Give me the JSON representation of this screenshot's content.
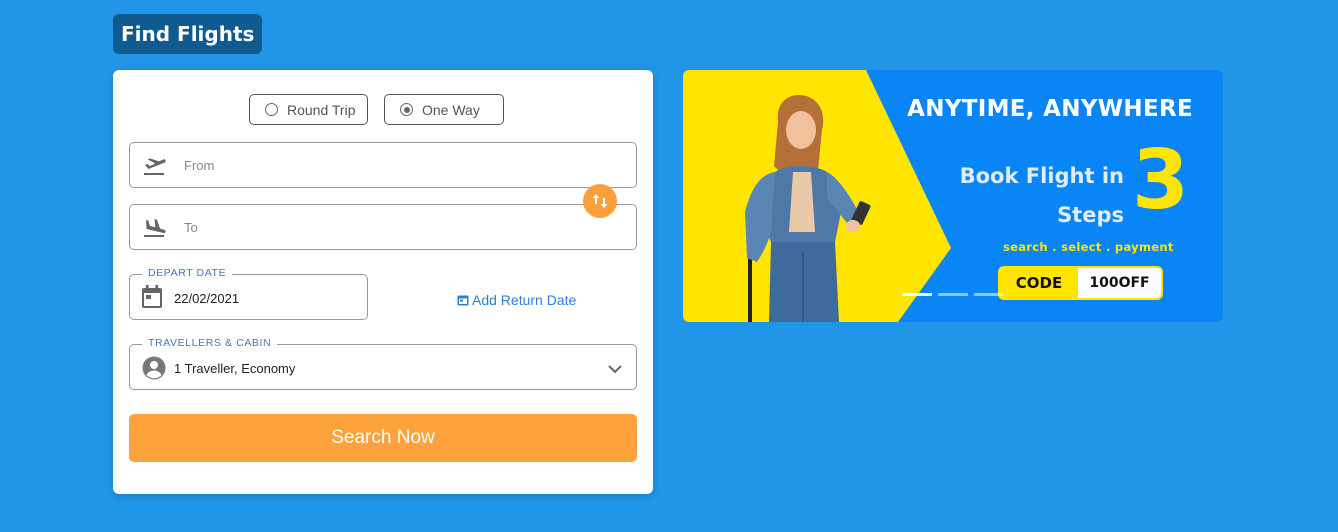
{
  "page": {
    "title": "Find Flights"
  },
  "trip_type": {
    "options": [
      {
        "label": "Round Trip",
        "selected": false
      },
      {
        "label": "One Way",
        "selected": true
      }
    ]
  },
  "from_field": {
    "placeholder": "From",
    "icon": "takeoff-icon"
  },
  "to_field": {
    "placeholder": "To",
    "icon": "landing-icon"
  },
  "swap": {
    "icon": "swap-vertical-icon"
  },
  "depart": {
    "label": "DEPART DATE",
    "value": "22/02/2021",
    "icon": "calendar-icon"
  },
  "return_link": {
    "label": "Add Return Date",
    "icon": "calendar-small-icon"
  },
  "travellers": {
    "label": "TRAVELLERS & CABIN",
    "value": "1 Traveller, Economy",
    "icon": "person-icon"
  },
  "search_button": {
    "label": "Search Now"
  },
  "banner": {
    "headline": "ANYTIME, ANYWHERE",
    "line1": "Book Flight in",
    "line2": "Steps",
    "number": "3",
    "tagline": "search . select . payment",
    "code_label": "CODE",
    "code_value": "100OFF",
    "slides": 3,
    "active_slide": 1
  },
  "colors": {
    "background": "#2196e8",
    "accent": "#fea33c",
    "title_bg": "#0f5a8f",
    "banner_blue": "#0a85f5",
    "banner_yellow": "#ffe500"
  }
}
